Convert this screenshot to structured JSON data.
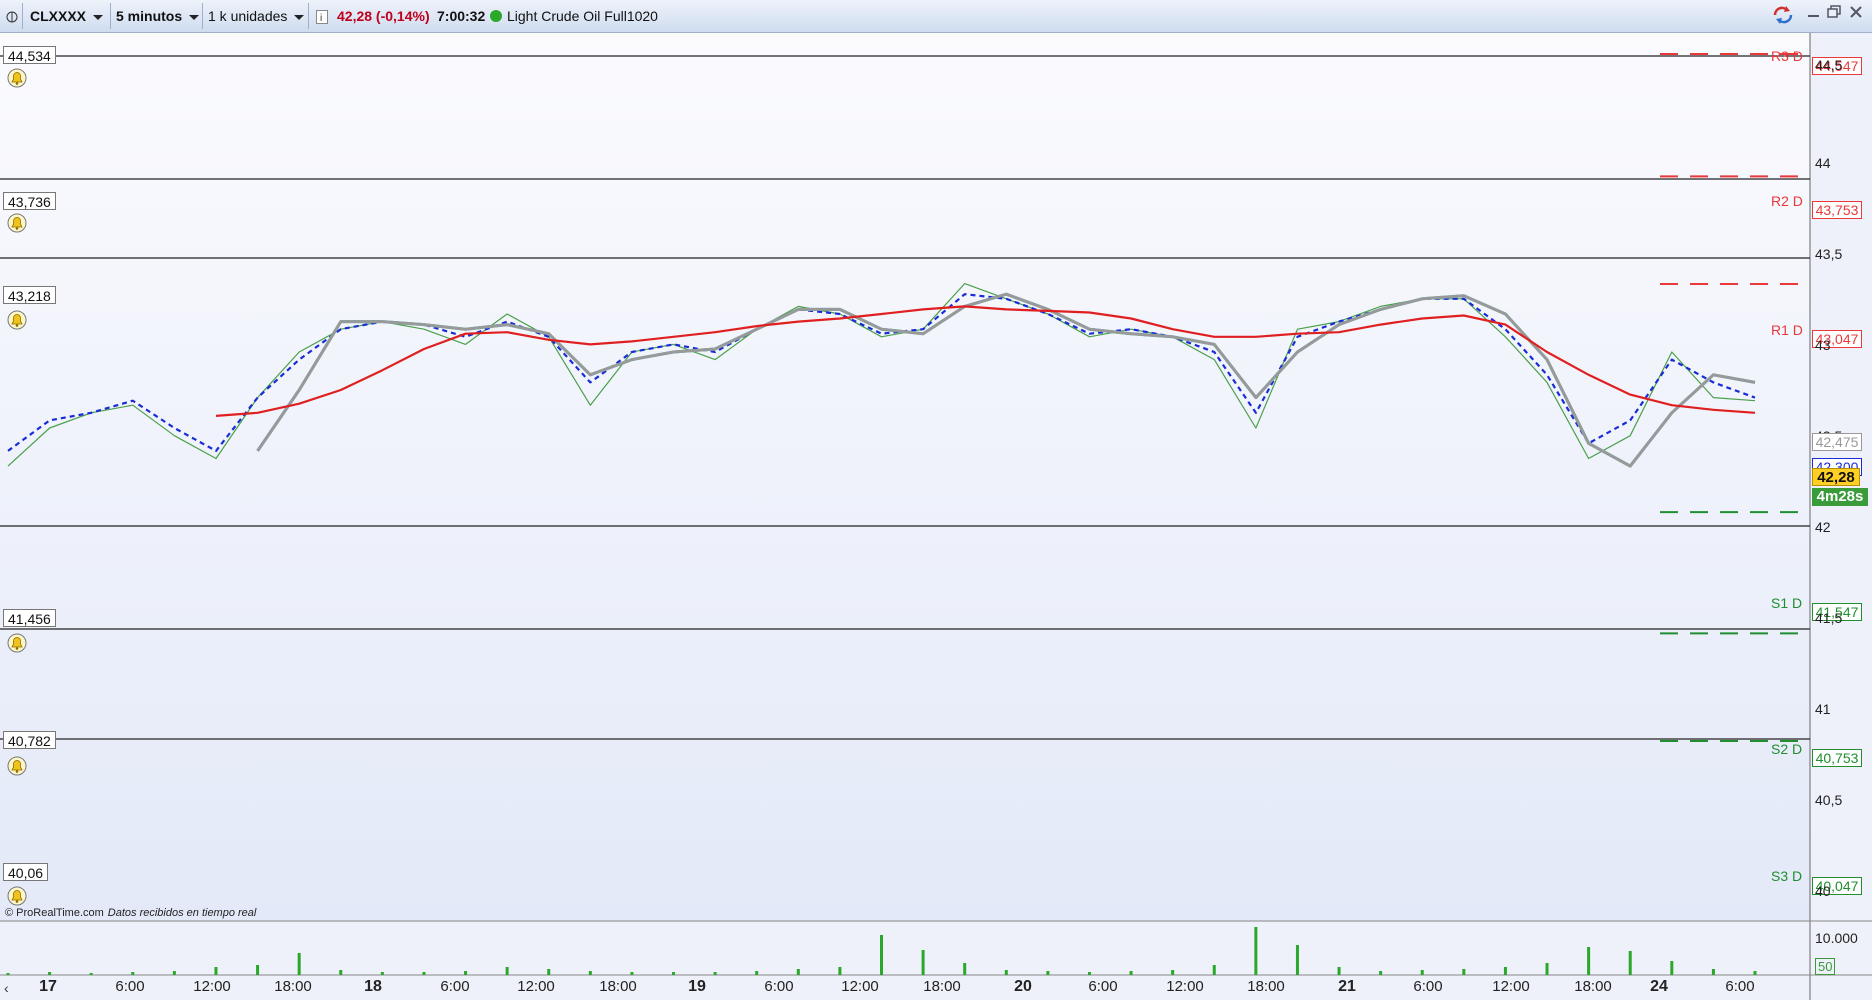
{
  "toolbar": {
    "grid_icon": "grid-icon",
    "symbol": "CLXXXX",
    "timeframe": "5 minutos",
    "units": "1 k unidades",
    "info_icon": "info-icon",
    "price_change": "42,28 (-0,14%)",
    "time": "7:00:32",
    "instrument": "Light Crude Oil Full1020",
    "status_color": "#2aa82a",
    "window_icons": [
      "sync-icon",
      "minimize-icon",
      "restore-icon",
      "close-icon"
    ]
  },
  "level_labels": [
    "44,534",
    "43,736",
    "43,218",
    "41,456",
    "40,782",
    "40,06"
  ],
  "pivots": [
    {
      "name": "R3 D",
      "value": "44,547",
      "color": "#e8383a"
    },
    {
      "name": "R2 D",
      "value": "43,753",
      "color": "#e8383a"
    },
    {
      "name": "R1 D",
      "value": "43,047",
      "color": "#e8383a"
    },
    {
      "name": "S1 D",
      "value": "41,547",
      "color": "#1f8f2f"
    },
    {
      "name": "S2 D",
      "value": "40,753",
      "color": "#1f8f2f"
    },
    {
      "name": "S3 D",
      "value": "40,047",
      "color": "#1f8f2f"
    }
  ],
  "right_axis": [
    "44,5",
    "44",
    "43,5",
    "43",
    "42,5",
    "42",
    "41,5",
    "41",
    "40,5",
    "40"
  ],
  "indicator_values": [
    "42,475",
    "42,300"
  ],
  "last_price": "42,28",
  "countdown": "4m28s",
  "copyright": "© ProRealTime.com",
  "data_note": "Datos recibidos en tiempo real",
  "volume_axis": [
    "10.000",
    "50"
  ],
  "x_axis": [
    "17",
    "6:00",
    "12:00",
    "18:00",
    "18",
    "6:00",
    "12:00",
    "18:00",
    "19",
    "6:00",
    "12:00",
    "18:00",
    "20",
    "6:00",
    "12:00",
    "18:00",
    "21",
    "6:00",
    "12:00",
    "18:00",
    "24",
    "6:00"
  ],
  "chart_data": {
    "type": "line",
    "instrument": "Light Crude Oil Full1020",
    "ylim": [
      39.9,
      44.7
    ],
    "x": [
      "17 00:00",
      "17 03:00",
      "17 06:00",
      "17 09:00",
      "17 12:00",
      "17 15:00",
      "17 18:00",
      "17 21:00",
      "18 00:00",
      "18 03:00",
      "18 06:00",
      "18 09:00",
      "18 12:00",
      "18 15:00",
      "18 18:00",
      "18 21:00",
      "19 00:00",
      "19 03:00",
      "19 06:00",
      "19 09:00",
      "19 12:00",
      "19 15:00",
      "19 18:00",
      "19 21:00",
      "20 00:00",
      "20 03:00",
      "20 06:00",
      "20 09:00",
      "20 12:00",
      "20 15:00",
      "20 18:00",
      "20 21:00",
      "21 00:00",
      "21 03:00",
      "21 06:00",
      "21 09:00",
      "21 12:00",
      "21 15:00",
      "21 18:00",
      "21 21:00",
      "24 00:00",
      "24 03:00",
      "24 06:00"
    ],
    "series": [
      {
        "color": "#4aa04a",
        "values": [
          41.85,
          42.1,
          42.2,
          42.25,
          42.05,
          41.9,
          42.3,
          42.6,
          42.75,
          42.8,
          42.75,
          42.65,
          42.85,
          42.7,
          42.25,
          42.6,
          42.65,
          42.55,
          42.75,
          42.9,
          42.85,
          42.7,
          42.75,
          43.05,
          42.95,
          42.85,
          42.7,
          42.75,
          42.7,
          42.55,
          42.1,
          42.75,
          42.8,
          42.9,
          42.95,
          42.95,
          42.7,
          42.4,
          41.9,
          42.05,
          42.6,
          42.3,
          42.28
        ]
      },
      {
        "color": "#1a2bd8",
        "values": [
          41.95,
          42.15,
          42.2,
          42.28,
          42.1,
          41.95,
          42.3,
          42.55,
          42.75,
          42.8,
          42.78,
          42.7,
          42.8,
          42.7,
          42.4,
          42.6,
          42.65,
          42.6,
          42.75,
          42.88,
          42.85,
          42.72,
          42.75,
          42.98,
          42.95,
          42.85,
          42.72,
          42.75,
          42.7,
          42.6,
          42.2,
          42.7,
          42.8,
          42.88,
          42.95,
          42.95,
          42.75,
          42.45,
          42.0,
          42.15,
          42.55,
          42.4,
          42.3
        ]
      },
      {
        "color": "#1ec8c8",
        "values": [
          null,
          null,
          null,
          null,
          null,
          null,
          41.95,
          42.35,
          42.8,
          42.8,
          42.78,
          42.75,
          42.78,
          42.72,
          42.45,
          42.55,
          42.6,
          42.62,
          42.75,
          42.88,
          42.88,
          42.75,
          42.72,
          42.9,
          42.98,
          42.88,
          42.75,
          42.72,
          42.7,
          42.65,
          42.3,
          42.6,
          42.78,
          42.88,
          42.95,
          42.97,
          42.85,
          42.55,
          42.0,
          41.85,
          42.2,
          42.45,
          42.4
        ]
      },
      {
        "color": "#999999",
        "values": [
          null,
          null,
          null,
          null,
          null,
          null,
          41.95,
          42.35,
          42.8,
          42.8,
          42.78,
          42.75,
          42.78,
          42.72,
          42.45,
          42.55,
          42.6,
          42.62,
          42.75,
          42.88,
          42.88,
          42.75,
          42.72,
          42.9,
          42.98,
          42.88,
          42.75,
          42.72,
          42.7,
          42.65,
          42.3,
          42.6,
          42.78,
          42.88,
          42.95,
          42.97,
          42.85,
          42.55,
          42.0,
          41.85,
          42.2,
          42.45,
          42.4
        ]
      },
      {
        "color": "#e02020",
        "values": [
          null,
          null,
          null,
          null,
          null,
          42.18,
          42.2,
          42.26,
          42.35,
          42.48,
          42.62,
          42.72,
          42.73,
          42.68,
          42.65,
          42.67,
          42.7,
          42.73,
          42.77,
          42.8,
          42.82,
          42.85,
          42.88,
          42.9,
          42.88,
          42.87,
          42.86,
          42.82,
          42.75,
          42.7,
          42.7,
          42.72,
          42.73,
          42.78,
          42.82,
          42.84,
          42.78,
          42.6,
          42.45,
          42.32,
          42.25,
          42.22,
          42.2
        ]
      }
    ],
    "horizontal_levels": [
      44.534,
      43.736,
      43.218,
      41.456,
      40.782,
      40.06
    ],
    "volume_color": "#2aa82a"
  }
}
